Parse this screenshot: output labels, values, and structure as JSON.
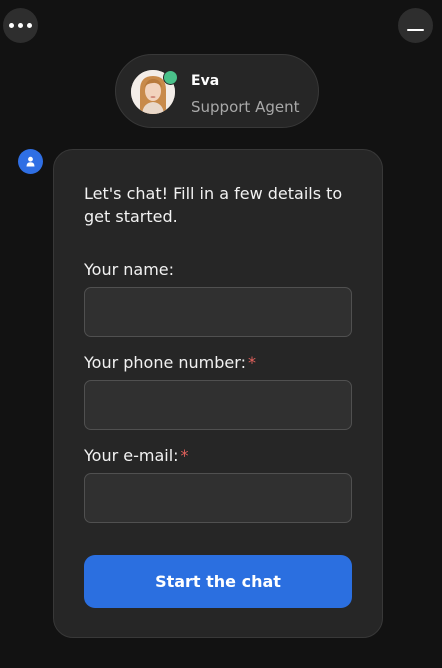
{
  "header": {
    "menu_icon": "ellipsis-icon",
    "minimize_icon": "minimize-icon"
  },
  "agent": {
    "name": "Eva",
    "role": "Support Agent",
    "status_color": "#4ac18a",
    "avatar_icon": "agent-avatar"
  },
  "chat": {
    "bot_icon": "user-icon",
    "intro": "Let's chat! Fill in a few details to get started.",
    "fields": [
      {
        "label": "Your name:",
        "required": false,
        "value": "",
        "placeholder": ""
      },
      {
        "label": "Your phone number:",
        "required": true,
        "value": "",
        "placeholder": ""
      },
      {
        "label": "Your e-mail:",
        "required": true,
        "value": "",
        "placeholder": ""
      }
    ],
    "required_marker": "*",
    "submit_label": "Start the chat"
  },
  "colors": {
    "accent": "#2b6fe0",
    "background": "#121212",
    "card": "#262626",
    "required": "#e2615c"
  }
}
